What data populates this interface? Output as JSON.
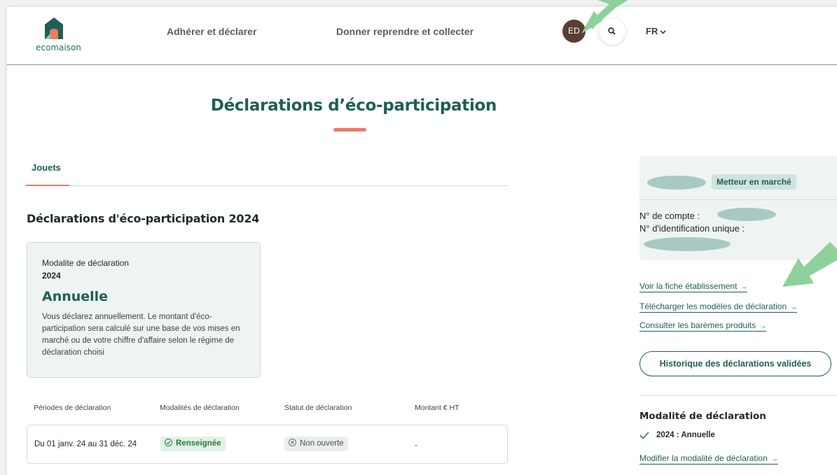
{
  "header": {
    "logo_text": "ecomaison",
    "nav": [
      "Adhérer et déclarer",
      "Donner reprendre et collecter"
    ],
    "avatar_initials": "ED",
    "language": "FR"
  },
  "page_title": "Déclarations d’éco-participation",
  "tabs": [
    {
      "label": "Jouets",
      "active": true
    }
  ],
  "section_title": "Déclarations d'éco-participation 2024",
  "modality_card": {
    "label": "Modalite de déclaration",
    "year": "2024",
    "value": "Annuelle",
    "description": "Vous déclarez annuellement. Le montant d'éco-participation sera calculé sur une base de vos mises en marché ou de votre chiffre d'affaire selon le régime de déclaration choisi"
  },
  "table": {
    "headers": [
      "Périodes de déclaration",
      "Modalités de déclaration",
      "Statut de déclaration",
      "Montant € HT"
    ],
    "rows": [
      {
        "period": "Du 01 janv. 24 au 31 déc. 24",
        "modality": "Renseignée",
        "status": "Non ouverte",
        "amount": "-"
      }
    ]
  },
  "account": {
    "role": "Metteur en marché",
    "account_number_label": "N° de compte :",
    "unique_id_label": "N° d'identification unique :"
  },
  "links": [
    "Voir la fiche établissement",
    "Télécharger les modèles de déclaration",
    "Consulter les barèmes produits"
  ],
  "history_button": "Historique des déclarations validées",
  "modality_panel": {
    "title": "Modalité de déclaration",
    "item": "2024 : Annuelle",
    "edit_link": "Modifier la modalité de déclaration"
  },
  "colors": {
    "brand_green": "#1d5f57",
    "accent_coral": "#ef7a61",
    "annotation_arrow": "#8fd19a"
  },
  "icons": {
    "arrow": "→",
    "chevron": "⌄"
  }
}
